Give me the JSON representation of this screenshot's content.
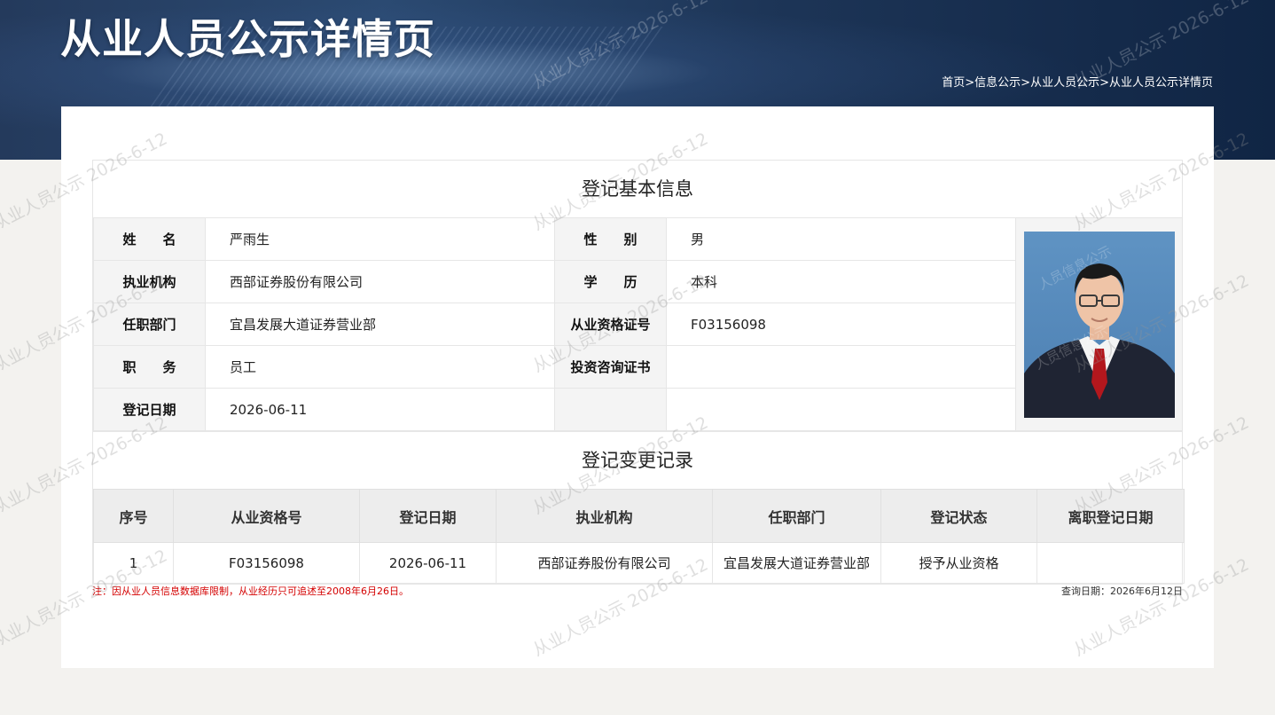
{
  "header": {
    "title": "从业人员公示详情页",
    "breadcrumb": {
      "home": "首页",
      "sep1": ">",
      "info": "信息公示",
      "sep2": ">",
      "staff": "从业人员公示",
      "sep3": ">",
      "current": "从业人员公示详情页"
    }
  },
  "basic_info": {
    "section_title": "登记基本信息",
    "name_label": "姓　　名",
    "name": "严雨生",
    "gender_label": "性　　别",
    "gender": "男",
    "org_label": "执业机构",
    "org": "西部证券股份有限公司",
    "edu_label": "学　　历",
    "edu": "本科",
    "dept_label": "任职部门",
    "dept": "宜昌发展大道证券营业部",
    "cert_label": "从业资格证号",
    "cert": "F03156098",
    "position_label": "职　　务",
    "position": "员工",
    "advisory_label": "投资咨询证书",
    "advisory": "",
    "reg_date_label": "登记日期",
    "reg_date": "2026-06-11"
  },
  "change_records": {
    "section_title": "登记变更记录",
    "columns": [
      "序号",
      "从业资格号",
      "登记日期",
      "执业机构",
      "任职部门",
      "登记状态",
      "离职登记日期"
    ],
    "rows": [
      [
        "1",
        "F03156098",
        "2026-06-11",
        "西部证券股份有限公司",
        "宜昌发展大道证券营业部",
        "授予从业资格",
        ""
      ]
    ]
  },
  "footer": {
    "note": "注：因从业人员信息数据库限制，从业经历只可追述至2008年6月26日。",
    "query_date": "查询日期：2026年6月12日"
  },
  "watermark": {
    "text": "从业人员公示 2026-6-12",
    "photo_text": "人员信息公示"
  }
}
